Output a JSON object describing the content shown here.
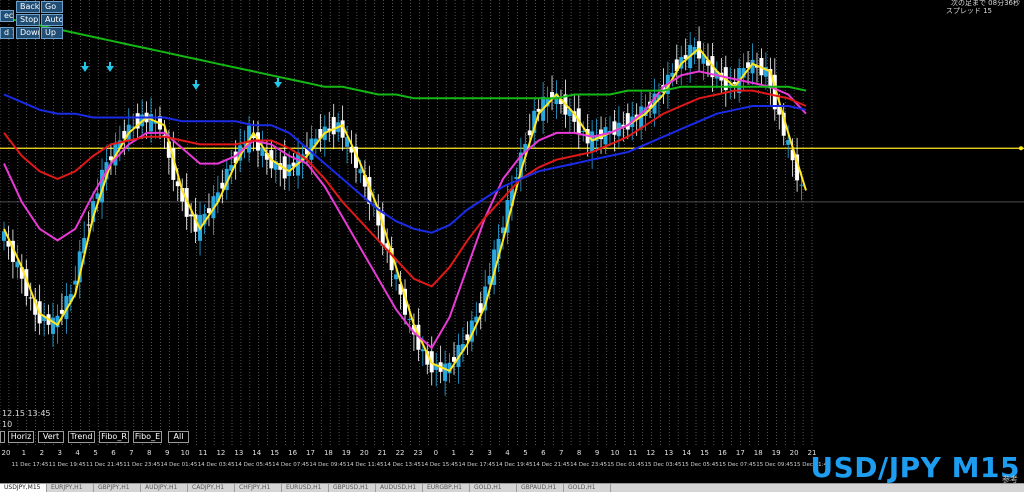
{
  "header": {
    "top_right_line1": "次の足まで 08分36秒",
    "top_right_line2": "スプレッド 15"
  },
  "controls": {
    "back": "Back",
    "go": "Go",
    "select_partial": "ect",
    "stop": "Stop",
    "auto": "Auto",
    "speed_partial": "d 1",
    "down": "Down",
    "up": "Up"
  },
  "bottom_info": {
    "date_line": "12.15 13:45",
    "count_line": "10"
  },
  "tools": {
    "h": "",
    "horiz": "Horiz",
    "vert": "Vert",
    "trend": "Trend",
    "fibo_r": "Fibo_R",
    "fibo_e": "Fibo_E",
    "all": "All"
  },
  "watermark": "USD/JPY M15",
  "bottom_right_glyph": "参考",
  "tabs": [
    "USDJPY,M15",
    "EURJPY,H1",
    "GBPJPY,H1",
    "AUDJPY,H1",
    "CADJPY,H1",
    "CHFJPY,H1",
    "EURUSD,H1",
    "GBPUSD,H1",
    "AUDUSD,H1",
    "EURGBP,H1",
    "GOLD,H1",
    "GBPAUD,H1",
    "GOLD,H1"
  ],
  "colors": {
    "bull": "#2aa7dd",
    "bear": "#ffffff",
    "ema_yellow": "#ffe81f",
    "ema_magenta": "#e83ad6",
    "ema_red": "#e01818",
    "ema_blue": "#1a2be8",
    "ema_green": "#14b814",
    "hline": "#ffe81f",
    "arrow": "#22c8e8"
  },
  "chart_data": {
    "type": "line",
    "hour_labels": [
      "20",
      "1",
      "2",
      "3",
      "4",
      "5",
      "6",
      "7",
      "8",
      "9",
      "10",
      "11",
      "12",
      "13",
      "14",
      "15",
      "16",
      "17",
      "18",
      "19",
      "20",
      "21",
      "22",
      "23",
      "0",
      "1",
      "2",
      "3",
      "4",
      "5",
      "6",
      "7",
      "8",
      "9",
      "10",
      "11",
      "12",
      "13",
      "14",
      "15",
      "16",
      "17",
      "18",
      "19",
      "20",
      "21"
    ],
    "time_labels": [
      "11 Dec 17:45",
      "11 Dec 19:45",
      "11 Dec 21:45",
      "11 Dec 23:45",
      "14 Dec 01:45",
      "14 Dec 03:45",
      "14 Dec 05:45",
      "14 Dec 07:45",
      "14 Dec 09:45",
      "14 Dec 11:45",
      "14 Dec 13:45",
      "14 Dec 15:45",
      "14 Dec 17:45",
      "14 Dec 19:45",
      "14 Dec 21:45",
      "14 Dec 23:45",
      "15 Dec 01:45",
      "15 Dec 03:45",
      "15 Dec 05:45",
      "15 Dec 07:45",
      "15 Dec 09:45",
      "15 Dec 11:45"
    ],
    "series": [
      {
        "color_key": "ema_yellow",
        "values": [
          0.55,
          0.45,
          0.33,
          0.3,
          0.38,
          0.58,
          0.72,
          0.8,
          0.84,
          0.82,
          0.65,
          0.55,
          0.62,
          0.72,
          0.8,
          0.73,
          0.7,
          0.74,
          0.8,
          0.82,
          0.72,
          0.6,
          0.45,
          0.3,
          0.2,
          0.18,
          0.25,
          0.35,
          0.52,
          0.7,
          0.85,
          0.9,
          0.85,
          0.78,
          0.8,
          0.82,
          0.85,
          0.9,
          0.98,
          1.02,
          0.96,
          0.92,
          0.98,
          0.96,
          0.8,
          0.65
        ]
      },
      {
        "color_key": "ema_magenta",
        "values": [
          0.72,
          0.62,
          0.55,
          0.52,
          0.55,
          0.64,
          0.72,
          0.77,
          0.8,
          0.8,
          0.76,
          0.72,
          0.72,
          0.74,
          0.78,
          0.77,
          0.74,
          0.72,
          0.66,
          0.58,
          0.5,
          0.42,
          0.34,
          0.28,
          0.24,
          0.32,
          0.45,
          0.58,
          0.68,
          0.74,
          0.78,
          0.8,
          0.8,
          0.79,
          0.8,
          0.82,
          0.86,
          0.92,
          0.95,
          0.96,
          0.95,
          0.94,
          0.93,
          0.92,
          0.9,
          0.85
        ]
      },
      {
        "color_key": "ema_red",
        "values": [
          0.8,
          0.74,
          0.7,
          0.68,
          0.7,
          0.74,
          0.77,
          0.78,
          0.79,
          0.79,
          0.78,
          0.77,
          0.77,
          0.77,
          0.78,
          0.78,
          0.76,
          0.73,
          0.68,
          0.62,
          0.57,
          0.52,
          0.47,
          0.42,
          0.4,
          0.45,
          0.52,
          0.58,
          0.63,
          0.68,
          0.71,
          0.73,
          0.74,
          0.75,
          0.77,
          0.79,
          0.82,
          0.85,
          0.87,
          0.89,
          0.9,
          0.91,
          0.91,
          0.9,
          0.89,
          0.87
        ]
      },
      {
        "color_key": "ema_blue",
        "values": [
          0.9,
          0.88,
          0.86,
          0.85,
          0.85,
          0.84,
          0.84,
          0.84,
          0.84,
          0.84,
          0.83,
          0.83,
          0.83,
          0.83,
          0.82,
          0.82,
          0.8,
          0.76,
          0.72,
          0.68,
          0.64,
          0.6,
          0.57,
          0.55,
          0.54,
          0.56,
          0.6,
          0.63,
          0.66,
          0.68,
          0.7,
          0.71,
          0.72,
          0.73,
          0.74,
          0.75,
          0.77,
          0.79,
          0.81,
          0.83,
          0.85,
          0.86,
          0.87,
          0.87,
          0.87,
          0.86
        ]
      },
      {
        "color_key": "ema_green",
        "values": [
          1.1,
          1.09,
          1.08,
          1.07,
          1.06,
          1.05,
          1.04,
          1.03,
          1.02,
          1.01,
          1.0,
          0.99,
          0.98,
          0.97,
          0.96,
          0.95,
          0.94,
          0.93,
          0.92,
          0.92,
          0.91,
          0.9,
          0.9,
          0.89,
          0.89,
          0.89,
          0.89,
          0.89,
          0.89,
          0.89,
          0.89,
          0.89,
          0.9,
          0.9,
          0.9,
          0.91,
          0.91,
          0.91,
          0.92,
          0.92,
          0.92,
          0.92,
          0.92,
          0.92,
          0.92,
          0.91
        ]
      }
    ],
    "horizontal_line_level": 0.76,
    "current_price_level": 0.62,
    "y_range": [
      0.0,
      1.12
    ],
    "grid": "vertical-dotted"
  }
}
